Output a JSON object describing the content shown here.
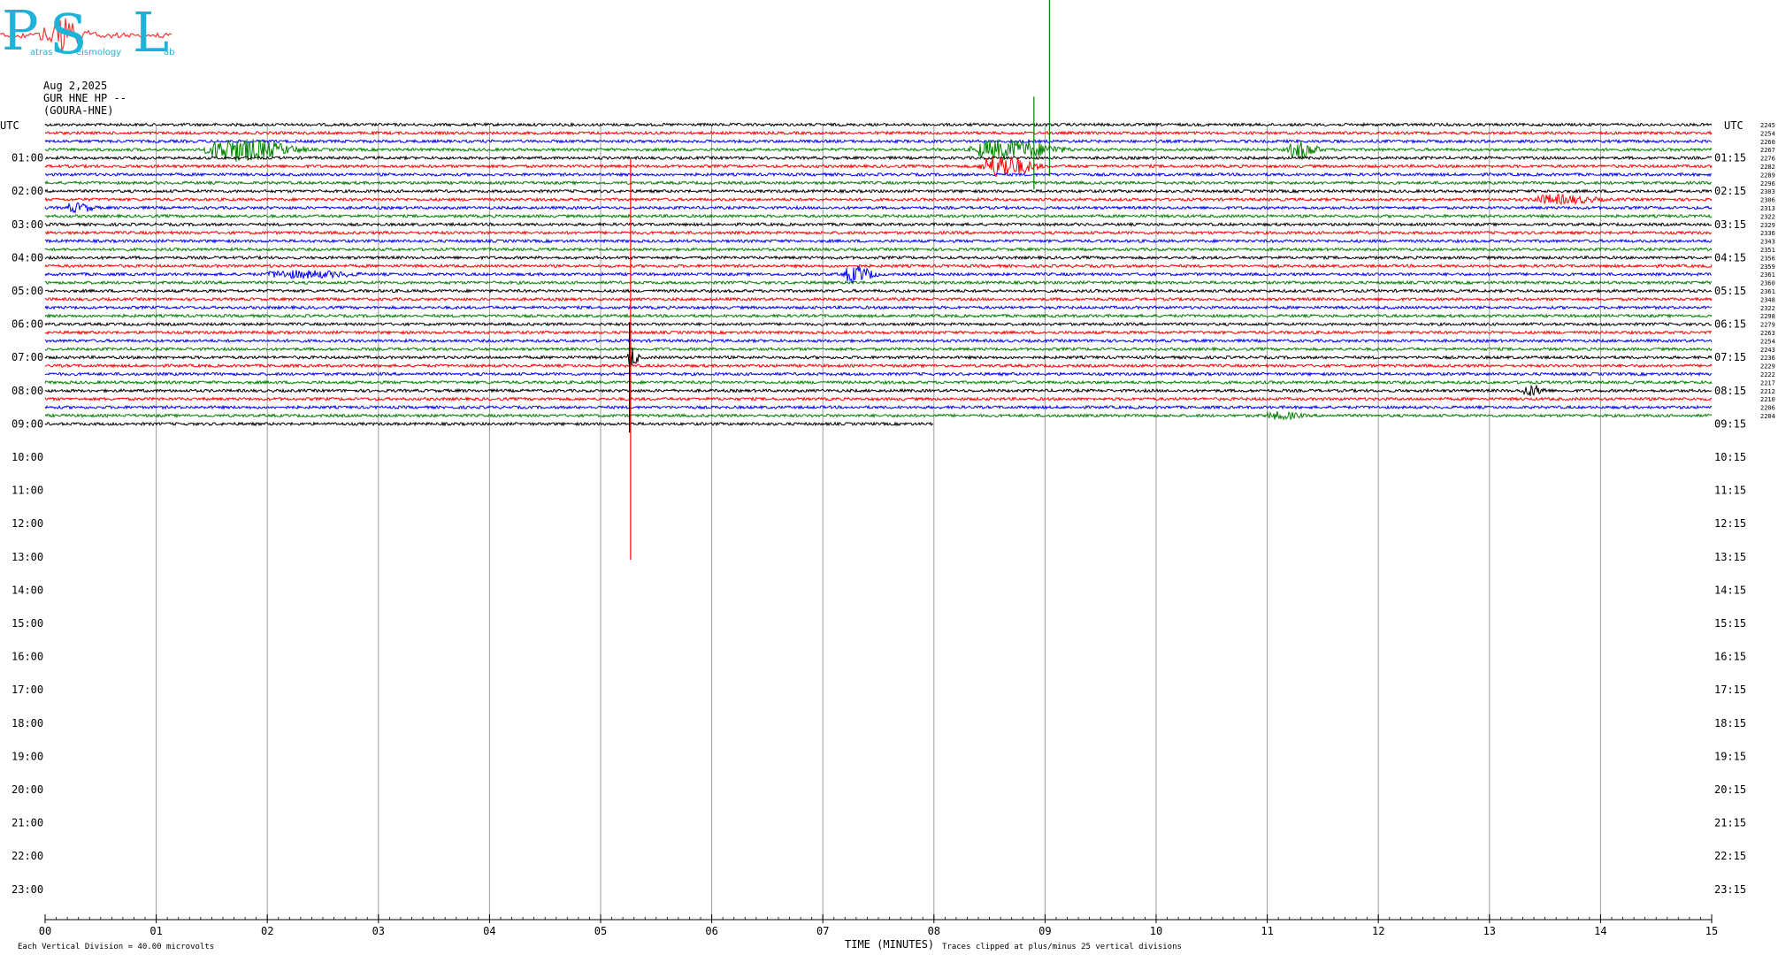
{
  "logo": {
    "letters": [
      "P",
      "S",
      "L"
    ],
    "words": [
      "atras",
      "eismology",
      "ab"
    ],
    "accent_color": "#1fb2d8",
    "trace_color": "#ff3030"
  },
  "header": {
    "date": "Aug 2,2025",
    "station": "GUR HNE HP --",
    "location": "(GOURA-HNE)"
  },
  "chart_data": {
    "type": "line",
    "title": "",
    "xlabel": "TIME (MINUTES)",
    "ylabel": "UTC",
    "left_axis_label": "UTC",
    "right_axis_label": "UTC",
    "xlim": [
      0,
      15
    ],
    "x_ticks": [
      "00",
      "01",
      "02",
      "03",
      "04",
      "05",
      "06",
      "07",
      "08",
      "09",
      "10",
      "11",
      "12",
      "13",
      "14",
      "15"
    ],
    "left_hour_labels": [
      "01:00",
      "02:00",
      "03:00",
      "04:00",
      "05:00",
      "06:00",
      "07:00",
      "08:00",
      "09:00",
      "10:00",
      "11:00",
      "12:00",
      "13:00",
      "14:00",
      "15:00",
      "16:00",
      "17:00",
      "18:00",
      "19:00",
      "20:00",
      "21:00",
      "22:00",
      "23:00"
    ],
    "right_hour_labels": [
      "01:15",
      "02:15",
      "03:15",
      "04:15",
      "05:15",
      "06:15",
      "07:15",
      "08:15",
      "09:15",
      "10:15",
      "11:15",
      "12:15",
      "13:15",
      "14:15",
      "15:15",
      "16:15",
      "17:15",
      "18:15",
      "19:15",
      "20:15",
      "21:15",
      "22:15",
      "23:15"
    ],
    "trace_colors": [
      "#000000",
      "#ff0000",
      "#0000ff",
      "#008000"
    ],
    "trace_count": 37,
    "traces_per_hour": 4,
    "last_trace_end_minute": 8.0,
    "trace_means": [
      "2245",
      "2254",
      "2260",
      "2267",
      "2276",
      "2282",
      "2289",
      "2296",
      "2303",
      "2306",
      "2313",
      "2322",
      "2329",
      "2336",
      "2343",
      "2351",
      "2356",
      "2359",
      "2361",
      "2360",
      "2361",
      "2348",
      "2322",
      "2298",
      "2279",
      "2263",
      "2254",
      "2243",
      "2236",
      "2229",
      "2222",
      "2217",
      "2212",
      "2210",
      "2206",
      "2204"
    ],
    "events": [
      {
        "trace": 3,
        "minute": 1.5,
        "width": 0.8,
        "amplitude": 14
      },
      {
        "trace": 3,
        "minute": 8.4,
        "width": 0.8,
        "amplitude": 12
      },
      {
        "trace": 3,
        "minute": 11.2,
        "width": 0.3,
        "amplitude": 10
      },
      {
        "trace": 5,
        "minute": 8.45,
        "width": 0.5,
        "amplitude": 14
      },
      {
        "trace": 9,
        "minute": 13.4,
        "width": 0.7,
        "amplitude": 6
      },
      {
        "trace": 10,
        "minute": 0.2,
        "width": 0.3,
        "amplitude": 6
      },
      {
        "trace": 18,
        "minute": 2.0,
        "width": 1.0,
        "amplitude": 5
      },
      {
        "trace": 18,
        "minute": 7.2,
        "width": 0.3,
        "amplitude": 10
      },
      {
        "trace": 28,
        "minute": 5.25,
        "width": 0.1,
        "amplitude": 14
      },
      {
        "trace": 32,
        "minute": 13.3,
        "width": 0.25,
        "amplitude": 7
      },
      {
        "trace": 35,
        "minute": 11.0,
        "width": 0.4,
        "amplitude": 5
      }
    ],
    "spikes": [
      {
        "trace": 3,
        "minute": 9.04,
        "up": 180,
        "down": 30
      },
      {
        "trace": 3,
        "minute": 8.9,
        "up": 60,
        "down": 45
      },
      {
        "trace": 5,
        "minute": 5.27,
        "up": 0,
        "down": 0,
        "long_down": true
      },
      {
        "trace": 28,
        "minute": 5.26,
        "up": 40,
        "down": 85
      }
    ],
    "footnotes": {
      "division": "Each Vertical Division =   40.00 microvolts",
      "clip": "Traces clipped at plus/minus 25 vertical divisions"
    },
    "grid": true
  }
}
